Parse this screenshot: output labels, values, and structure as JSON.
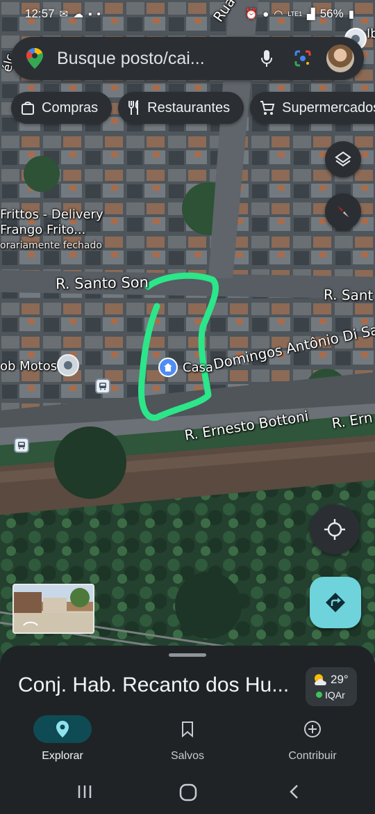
{
  "status_bar": {
    "time": "12:57",
    "battery": "56%",
    "net": "LTE1"
  },
  "search": {
    "placeholder": "Busque posto/cai..."
  },
  "chips": [
    "Compras",
    "Restaurantes",
    "Supermercados"
  ],
  "map_labels": {
    "street_santo_a": "R. Santo Son",
    "street_santo_b": "R. Sant",
    "street_domingos": "Domingos Antônio Di San",
    "street_ernesto": "R. Ernesto Bottoni",
    "street_ernesto_b": "R. Ern",
    "street_top": "Rua Gu",
    "street_left": "élc",
    "poi_name": "Frittos - Delivery\nFrango Frito...",
    "poi_status": "orariamente fechado",
    "poi_moto": "ob Motos",
    "casa": "Casa",
    "side": "Ib"
  },
  "place": {
    "title": "Conj. Hab. Recanto dos Hu..."
  },
  "weather": {
    "temp": "29°",
    "aqi_label": "IQAr",
    "aqi_color": "#3ec45a"
  },
  "nav": {
    "items": [
      {
        "label": "Explorar",
        "icon": "place-pin-icon"
      },
      {
        "label": "Salvos",
        "icon": "bookmark-icon"
      },
      {
        "label": "Contribuir",
        "icon": "add-circle-icon"
      }
    ]
  },
  "colors": {
    "accent": "#6fd3dc",
    "highlight": "#2ce68a",
    "surface": "#2b2f33"
  }
}
